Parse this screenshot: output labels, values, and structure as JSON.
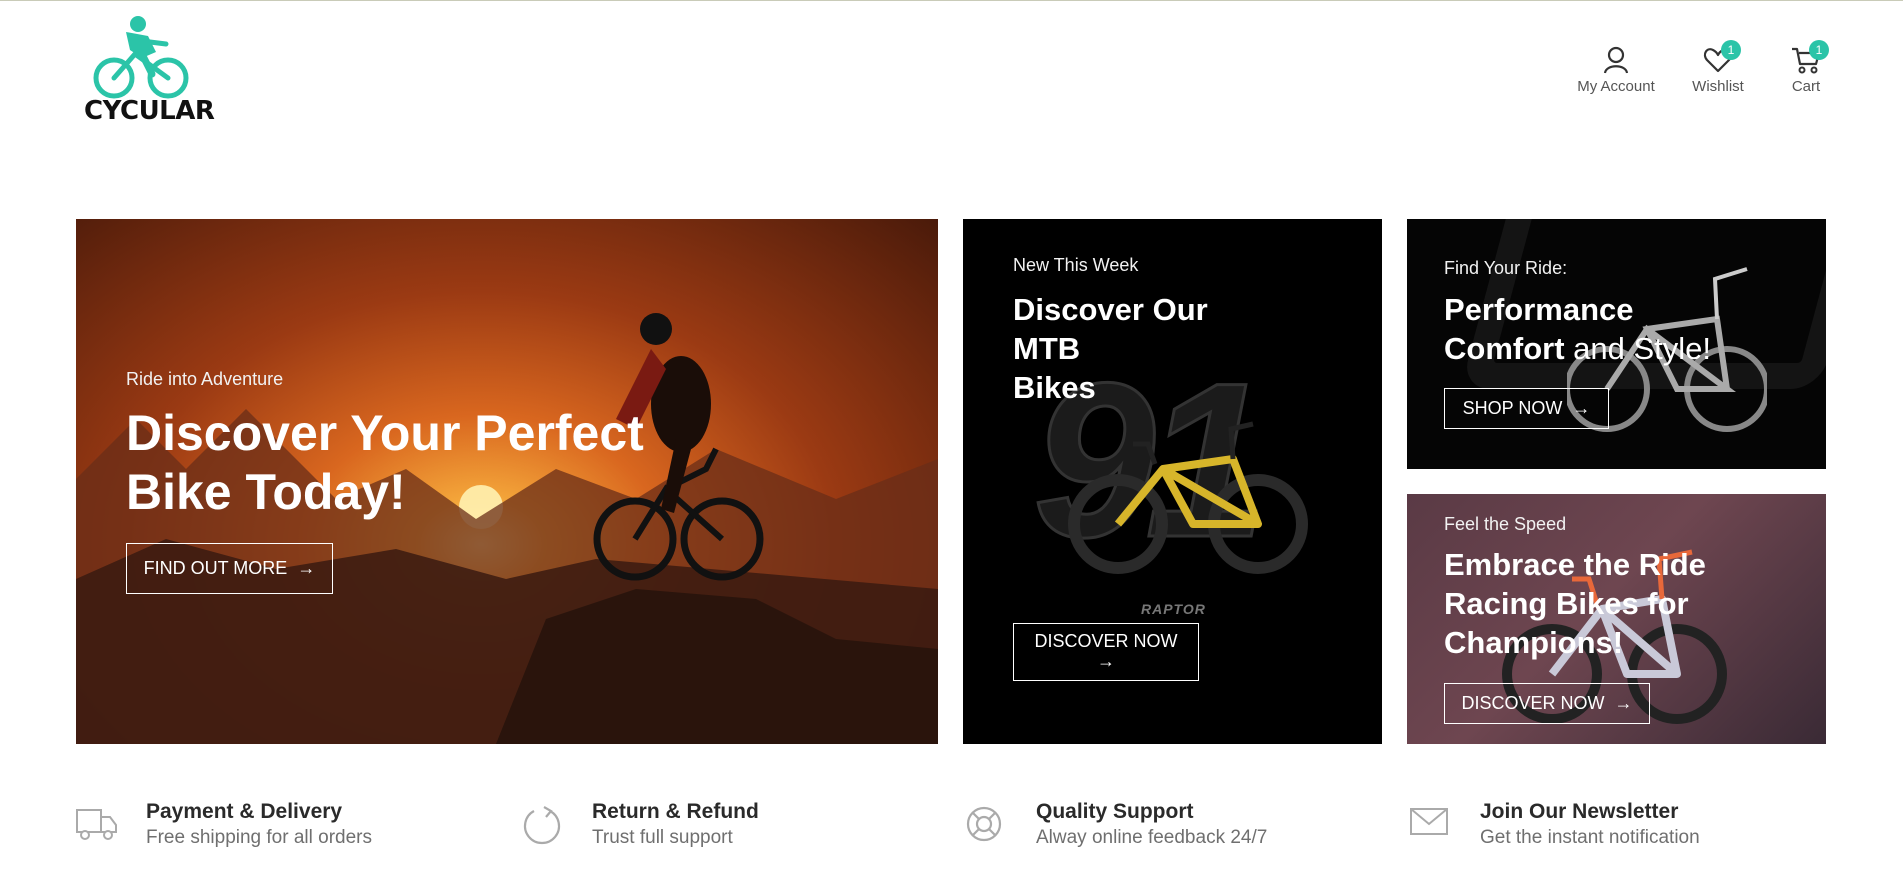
{
  "brand": {
    "name": "CYCULAR",
    "accent": "#2bc4a8"
  },
  "header": {
    "account": {
      "label": "My Account",
      "icon": "user-icon"
    },
    "wishlist": {
      "label": "Wishlist",
      "icon": "heart-icon",
      "count": "1"
    },
    "cart": {
      "label": "Cart",
      "icon": "cart-icon",
      "count": "1"
    }
  },
  "banners": {
    "main": {
      "eyebrow": "Ride into Adventure",
      "title_line1": "Discover Your Perfect",
      "title_line2": "Bike Today!",
      "button": "FIND OUT MORE"
    },
    "mtb": {
      "eyebrow": "New This Week",
      "title_line1": "Discover Our",
      "title_line2": "MTB",
      "title_line3": "Bikes",
      "button": "DISCOVER NOW",
      "watermark": "91",
      "bike_brand": "RAPTOR"
    },
    "performance": {
      "eyebrow": "Find Your Ride:",
      "title_line1": "Performance",
      "title_line2_bold": "Comfort",
      "title_line2_light": " and Style!",
      "button": "SHOP NOW"
    },
    "racing": {
      "eyebrow": "Feel the Speed",
      "title_line1": "Embrace the Ride",
      "title_line2": "Racing Bikes for",
      "title_line3": "Champions!",
      "button": "DISCOVER NOW"
    }
  },
  "features": [
    {
      "icon": "truck-icon",
      "title": "Payment & Delivery",
      "subtitle": "Free shipping for all orders"
    },
    {
      "icon": "refresh-icon",
      "title": "Return & Refund",
      "subtitle": "Trust full support"
    },
    {
      "icon": "lifebuoy-icon",
      "title": "Quality Support",
      "subtitle": "Alway online feedback 24/7"
    },
    {
      "icon": "mail-icon",
      "title": "Join Our Newsletter",
      "subtitle": "Get the instant notification"
    }
  ]
}
